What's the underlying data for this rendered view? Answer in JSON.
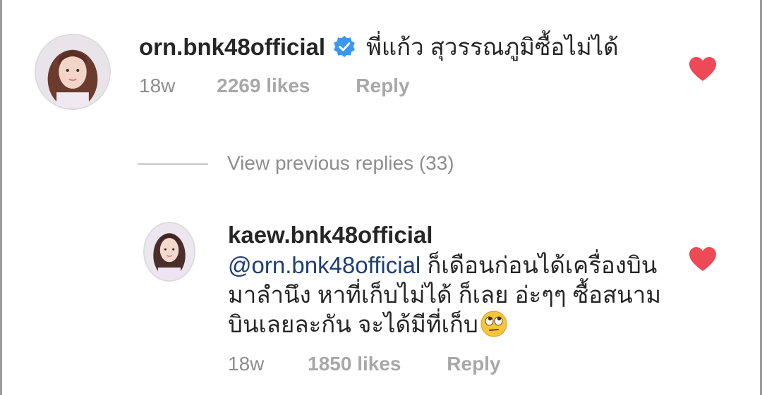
{
  "comment1": {
    "username": "orn.bnk48official",
    "text": "พี่แก้ว สุวรรณภูมิซื้อไม่ได้",
    "age": "18w",
    "likes": "2269 likes",
    "reply": "Reply",
    "verified_icon": "verified-badge-icon",
    "liked": true
  },
  "view_previous": "View previous replies (33)",
  "comment2": {
    "username": "kaew.bnk48official",
    "mention": "@orn.bnk48official",
    "text": " ก็เดือนก่อนได้เครื่องบินมาลำนึง หาที่เก็บไม่ได้ ก็เลย อ่ะๆๆ ซื้อสนามบินเลยละกัน จะได้มีที่เก็บ",
    "emoji_icon": "face-with-rolling-eyes-icon",
    "age": "18w",
    "likes": "1850 likes",
    "reply": "Reply",
    "liked": true
  },
  "colors": {
    "heart": "#ed4956",
    "verified": "#3897f0",
    "mention": "#1e3f74",
    "meta_text": "#8e8e8e"
  }
}
